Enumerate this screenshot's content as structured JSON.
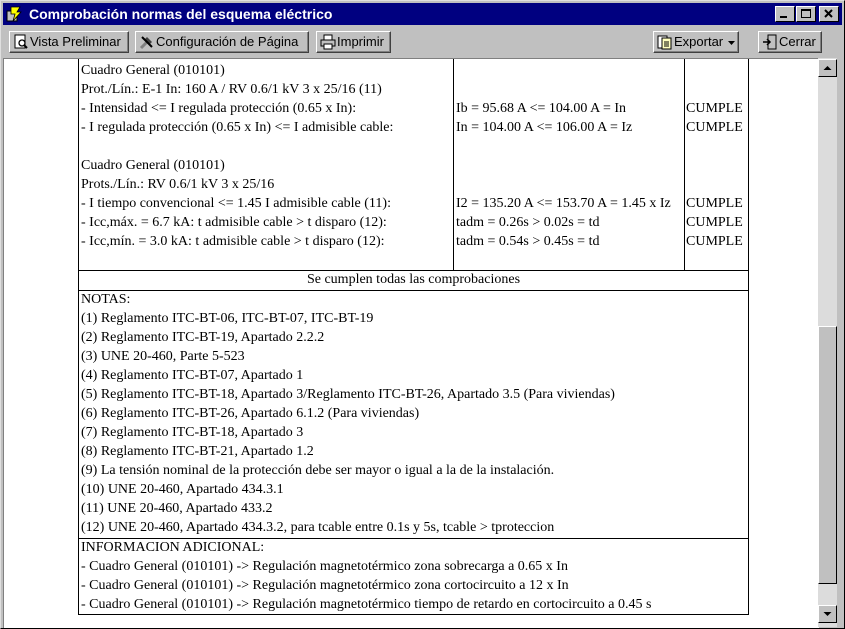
{
  "window": {
    "title": "Comprobación normas del esquema eléctrico"
  },
  "toolbar": {
    "preview_label": "Vista Preliminar",
    "page_setup_label": "Configuración de Página",
    "print_label": "Imprimir",
    "export_label": "Exportar",
    "close_label": "Cerrar"
  },
  "report": {
    "block1": {
      "lines": [
        "Cuadro General (010101)",
        "Prot./Lín.: E-1 In: 160 A / RV 0.6/1 kV 3 x 25/16 (11)",
        "- Intensidad <= I regulada protección (0.65 x In):",
        "- I regulada protección (0.65 x In) <= I admisible cable:"
      ],
      "results": [
        "Ib = 95.68 A <= 104.00 A = In",
        "In = 104.00 A <= 106.00 A = Iz"
      ],
      "status": [
        "CUMPLE",
        "CUMPLE"
      ]
    },
    "block2": {
      "lines": [
        "Cuadro General (010101)",
        "Prots./Lín.: RV 0.6/1 kV 3 x 25/16",
        "- I tiempo convencional <= 1.45 I admisible cable (11):",
        "- Icc,máx. = 6.7 kA: t admisible cable > t disparo (12):",
        "- Icc,mín. = 3.0 kA: t admisible cable > t disparo (12):"
      ],
      "results": [
        "I2 = 135.20 A <= 153.70 A = 1.45 x Iz",
        "tadm = 0.26s > 0.02s = td",
        "tadm = 0.54s > 0.45s = td"
      ],
      "status": [
        "CUMPLE",
        "CUMPLE",
        "CUMPLE"
      ]
    },
    "summary": "Se cumplen todas las comprobaciones",
    "notes_title": "NOTAS:",
    "notes": [
      "(1) Reglamento ITC-BT-06, ITC-BT-07, ITC-BT-19",
      "(2) Reglamento ITC-BT-19, Apartado 2.2.2",
      "(3) UNE 20-460, Parte 5-523",
      "(4) Reglamento ITC-BT-07, Apartado 1",
      "(5) Reglamento ITC-BT-18, Apartado 3/Reglamento ITC-BT-26, Apartado 3.5 (Para viviendas)",
      "(6) Reglamento ITC-BT-26, Apartado 6.1.2 (Para viviendas)",
      "(7) Reglamento ITC-BT-18, Apartado 3",
      "(8) Reglamento ITC-BT-21, Apartado 1.2",
      "(9) La tensión nominal de la protección debe ser mayor o igual a la de la instalación.",
      "(10) UNE 20-460, Apartado 434.3.1",
      "(11) UNE 20-460, Apartado 433.2",
      "(12) UNE 20-460, Apartado 434.3.2, para tcable entre 0.1s y 5s, tcable > tproteccion"
    ],
    "info_title": "INFORMACION ADICIONAL:",
    "info": [
      "- Cuadro General (010101) -> Regulación magnetotérmico zona sobrecarga a 0.65 x In",
      "- Cuadro General (010101) -> Regulación magnetotérmico zona cortocircuito a 12 x In",
      "- Cuadro General (010101) -> Regulación magnetotérmico tiempo de retardo en cortocircuito a 0.45 s"
    ]
  }
}
